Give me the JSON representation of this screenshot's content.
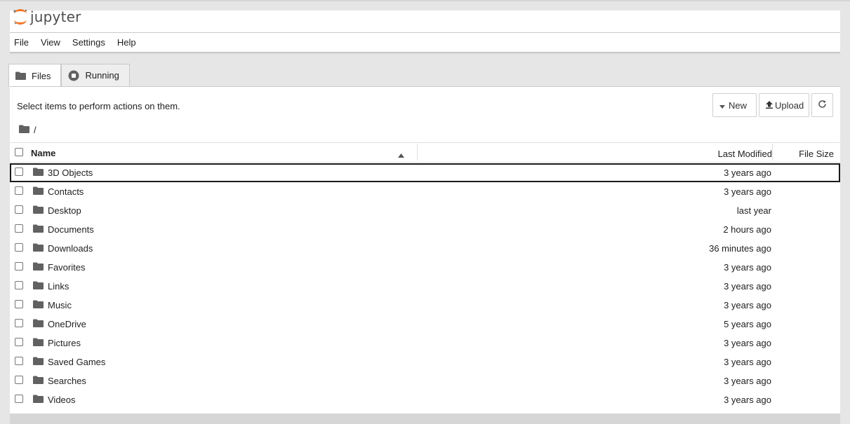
{
  "app": {
    "logo_text": "jupyter"
  },
  "menu": {
    "items": [
      "File",
      "View",
      "Settings",
      "Help"
    ]
  },
  "tabs": [
    {
      "label": "Files",
      "icon": "folder-icon",
      "active": true
    },
    {
      "label": "Running",
      "icon": "stop-circle-icon",
      "active": false
    }
  ],
  "toolbar": {
    "instructions": "Select items to perform actions on them.",
    "new_label": "New",
    "upload_label": "Upload",
    "refresh_icon": "refresh-icon"
  },
  "breadcrumb": {
    "path": "/"
  },
  "list": {
    "headers": {
      "name": "Name",
      "modified": "Last Modified",
      "size": "File Size"
    },
    "sort": "name-ascending",
    "rows": [
      {
        "name": "3D Objects",
        "modified": "3 years ago",
        "selected": true
      },
      {
        "name": "Contacts",
        "modified": "3 years ago"
      },
      {
        "name": "Desktop",
        "modified": "last year"
      },
      {
        "name": "Documents",
        "modified": "2 hours ago"
      },
      {
        "name": "Downloads",
        "modified": "36 minutes ago"
      },
      {
        "name": "Favorites",
        "modified": "3 years ago"
      },
      {
        "name": "Links",
        "modified": "3 years ago"
      },
      {
        "name": "Music",
        "modified": "3 years ago"
      },
      {
        "name": "OneDrive",
        "modified": "5 years ago"
      },
      {
        "name": "Pictures",
        "modified": "3 years ago"
      },
      {
        "name": "Saved Games",
        "modified": "3 years ago"
      },
      {
        "name": "Searches",
        "modified": "3 years ago"
      },
      {
        "name": "Videos",
        "modified": "3 years ago"
      }
    ]
  },
  "colors": {
    "accent_orange": "#f37726",
    "selected_outline": "#1a1a1a"
  }
}
